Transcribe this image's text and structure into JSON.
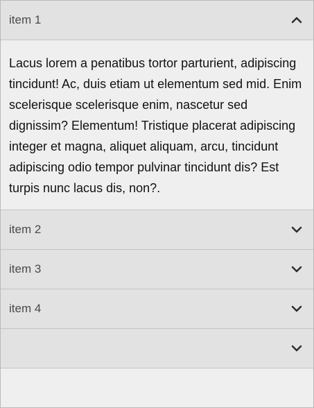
{
  "accordion": {
    "items": [
      {
        "title": "item 1",
        "expanded": true,
        "icon": "chevron-up-icon",
        "content": "Lacus lorem a penatibus tortor parturient, adipiscing tincidunt! Ac, duis etiam ut elementum sed mid. Enim scelerisque scelerisque enim, nascetur sed dignissim? Elementum! Tristique placerat adipiscing integer et magna, aliquet aliquam, arcu, tincidunt adipiscing odio tempor pulvinar tincidunt dis? Est turpis nunc lacus dis, non?."
      },
      {
        "title": "item 2",
        "expanded": false,
        "icon": "chevron-down-icon"
      },
      {
        "title": "item 3",
        "expanded": false,
        "icon": "chevron-down-icon"
      },
      {
        "title": "item 4",
        "expanded": false,
        "icon": "chevron-down-icon"
      }
    ]
  }
}
